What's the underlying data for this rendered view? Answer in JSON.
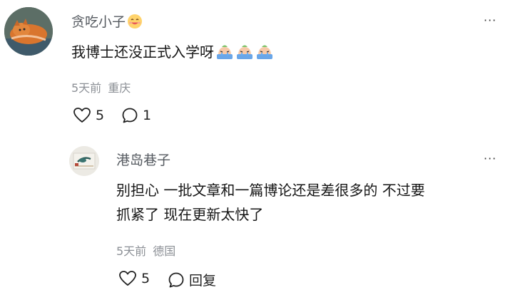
{
  "comment": {
    "username": "贪吃小子",
    "content": "我博士还没正式入学呀",
    "content_emojis": [
      "crying-face-emoji",
      "crying-face-emoji",
      "crying-face-emoji"
    ],
    "time": "5天前",
    "location": "重庆",
    "likes": "5",
    "replies": "1"
  },
  "reply": {
    "username": "港岛巷子",
    "content_line1": "别担心 一批文章和一篇博论还是差很多的 不过要",
    "content_line2": "抓紧了 现在更新太快了",
    "time": "5天前",
    "location": "德国",
    "likes": "5",
    "reply_label": "回复"
  },
  "more_menu_label": "···"
}
